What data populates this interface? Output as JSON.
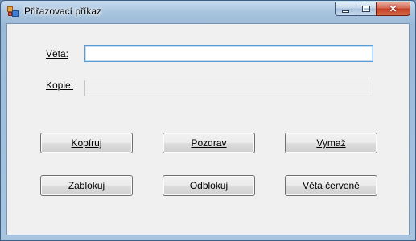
{
  "window": {
    "title": "Přiřazovací příkaz"
  },
  "form": {
    "veta_label": "Věta:",
    "veta_value": "",
    "kopie_label": "Kopie:",
    "kopie_value": ""
  },
  "buttons": {
    "kopiruj": "Kopíruj",
    "pozdrav": "Pozdrav",
    "vymaz": "Vymaž",
    "zablokuj": "Zablokuj",
    "odblokuj": "Odblokuj",
    "veta_cervene": "Věta červeně"
  },
  "caption": {
    "close_glyph": "✕"
  }
}
